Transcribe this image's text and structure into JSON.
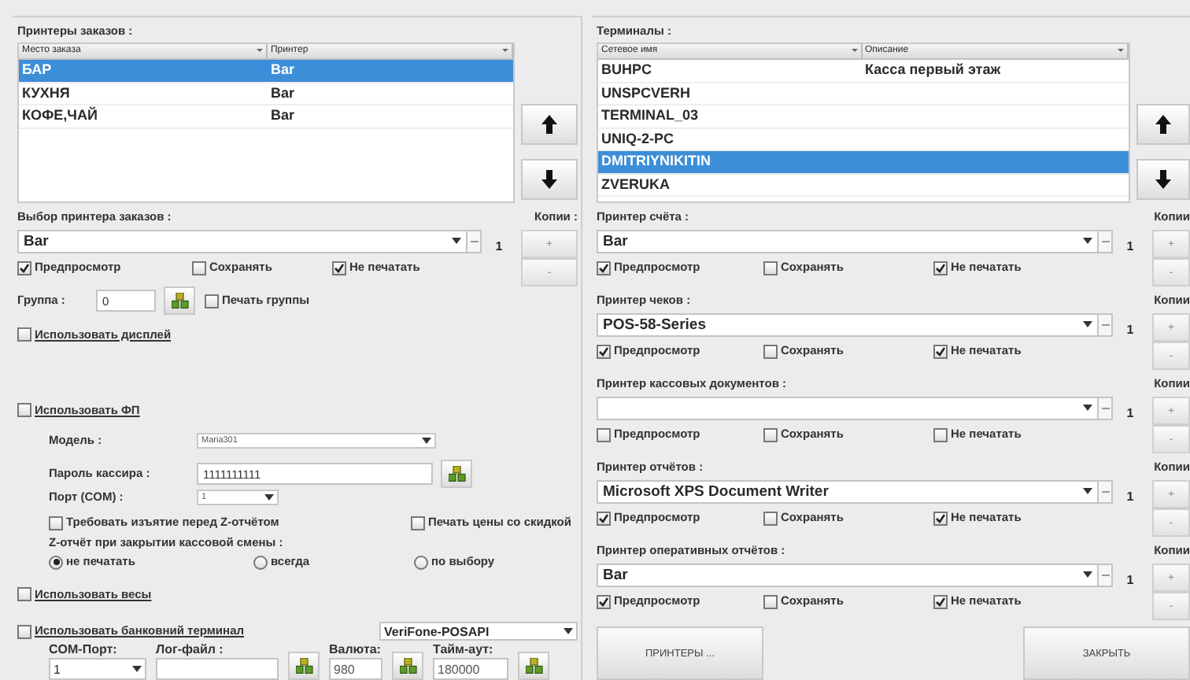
{
  "order_printers": {
    "title": "Принтеры заказов :",
    "columns": [
      "Место заказа",
      "Принтер"
    ],
    "rows": [
      {
        "cells": [
          "БАР",
          "Bar"
        ],
        "selected": true
      },
      {
        "cells": [
          "КУХНЯ",
          "Bar"
        ],
        "selected": false
      },
      {
        "cells": [
          "КОФЕ,ЧАЙ",
          "Bar"
        ],
        "selected": false
      }
    ]
  },
  "order_printer_select": {
    "label": "Выбор принтера заказов :",
    "copies_label": "Копии :",
    "value": "Bar",
    "copies": "1",
    "plus": "+",
    "minus": "-",
    "options": [
      {
        "label": "Предпросмотр",
        "checked": true
      },
      {
        "label": "Сохранять",
        "checked": false
      },
      {
        "label": "Не печатать",
        "checked": true
      }
    ]
  },
  "group": {
    "label": "Группа :",
    "value": "0"
  },
  "print_group": {
    "label": "Печать группы",
    "checked": false
  },
  "use_display": {
    "label": "Использовать дисплей",
    "checked": false
  },
  "fiscal": {
    "use": {
      "label": "Использовать ФП",
      "checked": false
    },
    "model_label": "Модель :",
    "model": "Maria301",
    "password_label": "Пароль кассира :",
    "password": "1111111111",
    "port_label": "Порт (COM) :",
    "port": "1",
    "require_withdrawal": {
      "label": "Требовать изъятие перед Z-отчётом",
      "checked": false
    },
    "print_discount": {
      "label": "Печать цены со скидкой",
      "checked": false
    },
    "z_report_label": "Z-отчёт при закрытии кассовой смены :",
    "z_report_options": [
      {
        "label": "не печатать",
        "selected": true
      },
      {
        "label": "всегда",
        "selected": false
      },
      {
        "label": "по выбору",
        "selected": false
      }
    ]
  },
  "use_scales": {
    "label": "Использовать весы",
    "checked": false
  },
  "bank_terminal": {
    "use": {
      "label": "Использовать банковний терминал",
      "checked": false
    },
    "model": "VeriFone-POSAPI",
    "fields": [
      {
        "label": "COM-Порт:",
        "value": "1",
        "kind": "dropdown"
      },
      {
        "label": "Лог-файл :",
        "kind": "input"
      },
      {
        "label": "Валюта:",
        "value": "980",
        "kind": "input"
      },
      {
        "label": "Тайм-аут:",
        "value": "180000",
        "kind": "input"
      }
    ]
  },
  "terminals": {
    "title": "Терминалы :",
    "columns": [
      "Сетевое имя",
      "Описание"
    ],
    "rows": [
      {
        "cells": [
          "BUHPC",
          "Касса первый этаж"
        ],
        "selected": false
      },
      {
        "cells": [
          "UNSPCVERH"
        ],
        "selected": false
      },
      {
        "cells": [
          "TERMINAL_03"
        ],
        "selected": false
      },
      {
        "cells": [
          "UNIQ-2-PC"
        ],
        "selected": false
      },
      {
        "cells": [
          "DMITRIYNIKITIN"
        ],
        "selected": true
      },
      {
        "cells": [
          "ZVERUKA"
        ],
        "selected": false
      }
    ]
  },
  "printer_sections": [
    {
      "label": "Принтер счёта :",
      "copies_label": "Копии",
      "value": "Bar",
      "copies": "1",
      "plus": "+",
      "minus": "-",
      "options": [
        {
          "label": "Предпросмотр",
          "checked": true
        },
        {
          "label": "Сохранять",
          "checked": false
        },
        {
          "label": "Не печатать",
          "checked": true
        }
      ]
    },
    {
      "label": "Принтер чеков :",
      "copies_label": "Копии",
      "value": "POS-58-Series",
      "copies": "1",
      "plus": "+",
      "minus": "-",
      "options": [
        {
          "label": "Предпросмотр",
          "checked": true
        },
        {
          "label": "Сохранять",
          "checked": false
        },
        {
          "label": "Не печатать",
          "checked": true
        }
      ]
    },
    {
      "label": "Принтер кассовых документов :",
      "copies_label": "Копии",
      "copies": "1",
      "plus": "+",
      "minus": "-",
      "options": [
        {
          "label": "Предпросмотр",
          "checked": false
        },
        {
          "label": "Сохранять",
          "checked": false
        },
        {
          "label": "Не печатать",
          "checked": false
        }
      ]
    },
    {
      "label": "Принтер отчётов :",
      "copies_label": "Копии",
      "value": "Microsoft XPS Document Writer",
      "copies": "1",
      "plus": "+",
      "minus": "-",
      "options": [
        {
          "label": "Предпросмотр",
          "checked": true
        },
        {
          "label": "Сохранять",
          "checked": false
        },
        {
          "label": "Не печатать",
          "checked": true
        }
      ]
    },
    {
      "label": "Принтер оперативных отчётов :",
      "copies_label": "Копии",
      "value": "Bar",
      "copies": "1",
      "plus": "+",
      "minus": "-",
      "options": [
        {
          "label": "Предпросмотр",
          "checked": true
        },
        {
          "label": "Сохранять",
          "checked": false
        },
        {
          "label": "Не печатать",
          "checked": true
        }
      ]
    }
  ],
  "buttons": [
    "ПРИНТЕРЫ ...",
    "ЗАКРЫТЬ"
  ]
}
